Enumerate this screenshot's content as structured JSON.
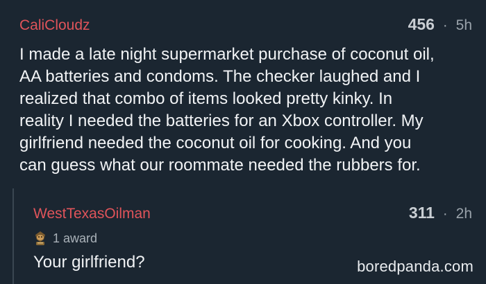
{
  "top_comment": {
    "username": "CaliCloudz",
    "score": "456",
    "separator": "·",
    "age": "5h",
    "text": "I made a late night supermarket purchase of coconut oil,\nAA batteries and condoms. The checker laughed and I\nrealized that combo of items looked pretty kinky. In\nreality I needed the batteries for an Xbox controller. My\ngirlfriend needed the coconut oil for cooking. And you\ncan guess what our roommate needed the rubbers for."
  },
  "reply_comment": {
    "username": "WestTexasOilman",
    "score": "311",
    "separator": "·",
    "age": "2h",
    "award_icon": "award-badge-icon",
    "award_text": "1 award",
    "text": "Your girlfriend?"
  },
  "watermark": "boredpanda.com",
  "colors": {
    "background": "#1b2631",
    "username": "#e0545a",
    "text": "#f1f3f5",
    "meta": "#9aa3ab"
  }
}
